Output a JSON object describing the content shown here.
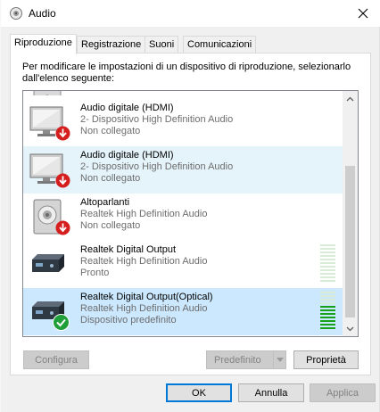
{
  "window": {
    "title": "Audio"
  },
  "tabs": [
    {
      "label": "Riproduzione",
      "active": true
    },
    {
      "label": "Registrazione",
      "active": false
    },
    {
      "label": "Suoni",
      "active": false
    },
    {
      "label": "Comunicazioni",
      "active": false
    }
  ],
  "instructions": "Per modificare le impostazioni di un dispositivo di riproduzione, selezionarlo dall'elenco seguente:",
  "devices": [
    {
      "name": "Audio digitale (HDMI)",
      "driver": "2- Dispositivo High Definition Audio",
      "status": "Non collegato",
      "icon": "monitor-icon",
      "badge": "disconnected-icon"
    },
    {
      "name": "Audio digitale (HDMI)",
      "driver": "2- Dispositivo High Definition Audio",
      "status": "Non collegato",
      "icon": "monitor-icon",
      "badge": "disconnected-icon"
    },
    {
      "name": "Altoparlanti",
      "driver": "Realtek High Definition Audio",
      "status": "Non collegato",
      "icon": "speaker-icon",
      "badge": "disconnected-icon"
    },
    {
      "name": "Realtek Digital Output",
      "driver": "Realtek High Definition Audio",
      "status": "Pronto",
      "icon": "digital-output-icon",
      "badge": ""
    },
    {
      "name": "Realtek Digital Output(Optical)",
      "driver": "Realtek High Definition Audio",
      "status": "Dispositivo predefinito",
      "icon": "digital-output-icon",
      "badge": "default-check-icon"
    }
  ],
  "meters": {
    "ready_device_level": 0.0,
    "default_device_level": 0.6
  },
  "buttons": {
    "configure": "Configura",
    "set_default": "Predefinito",
    "properties": "Proprietà",
    "ok": "OK",
    "cancel": "Annulla",
    "apply": "Applica"
  },
  "colors": {
    "selection": "#cce8ff",
    "hover": "#e5f3fb",
    "disconnected": "#d51f1f",
    "default_check": "#1e9f3a",
    "meter_on": "#18a218"
  }
}
